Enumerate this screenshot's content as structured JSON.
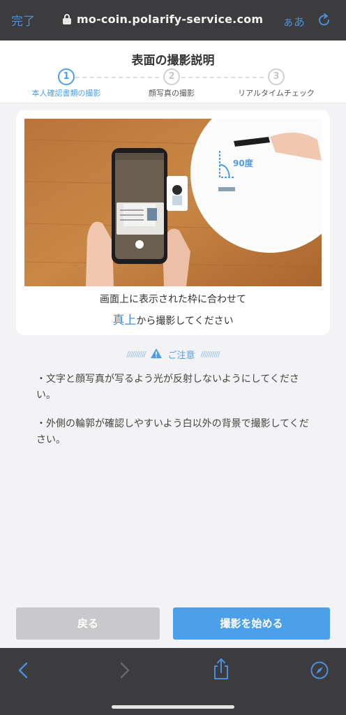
{
  "browser": {
    "done_label": "完了",
    "url": "mo-coin.polarify-service.com",
    "text_size_label": "ぁあ"
  },
  "header": {
    "title": "表面の撮影説明",
    "steps": [
      {
        "number": "1",
        "label": "本人確認書類の撮影",
        "active": true
      },
      {
        "number": "2",
        "label": "顔写真の撮影",
        "active": false
      },
      {
        "number": "3",
        "label": "リアルタイムチェック",
        "active": false
      }
    ]
  },
  "instruction": {
    "line1": "画面上に表示された枠に合わせて",
    "line2_emphasis": "真上",
    "line2_rest": "から撮影してください",
    "angle_label": "90度"
  },
  "caution": {
    "title": "ご注意",
    "notes": [
      "・文字と顔写真が写るよう光が反射しないようにしてください。",
      "・外側の輪郭が確認しやすいよう白以外の背景で撮影してください。"
    ]
  },
  "buttons": {
    "back": "戻る",
    "start": "撮影を始める"
  },
  "colors": {
    "accent": "#4c9fe9",
    "browser_bar": "#3c3c3e",
    "back_button": "#c9c9cc"
  }
}
